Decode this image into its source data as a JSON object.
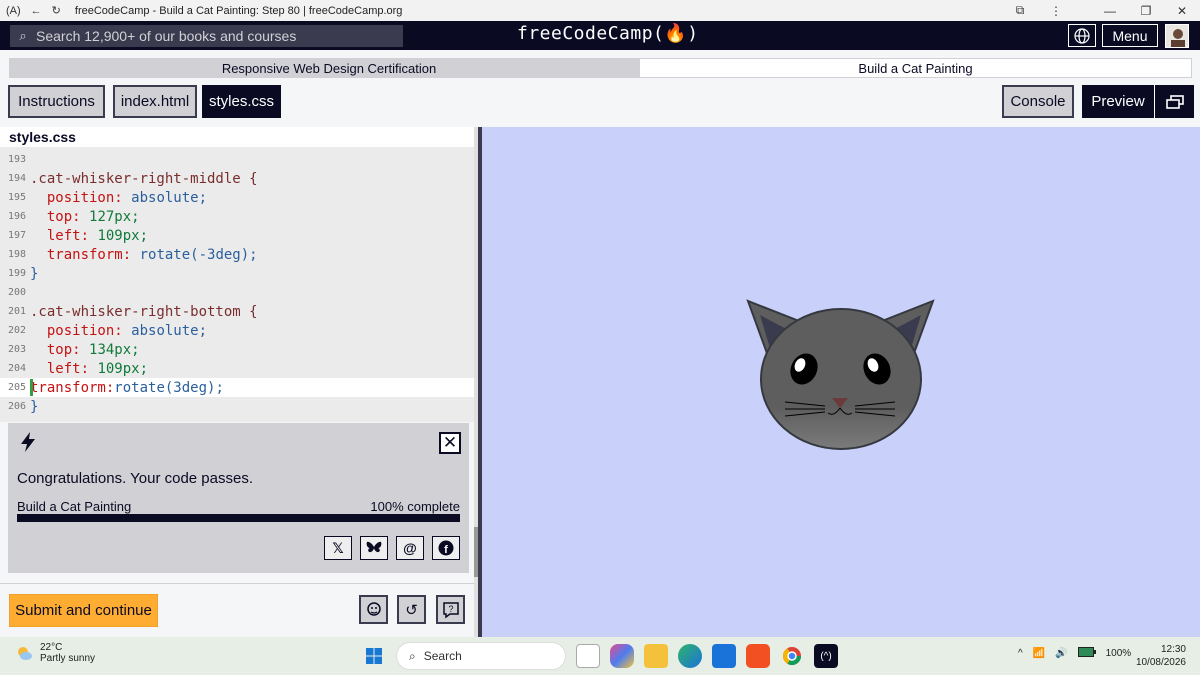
{
  "browser": {
    "title": "freeCodeCamp - Build a Cat Painting: Step 80 | freeCodeCamp.org",
    "badge": "(A)"
  },
  "nav": {
    "search_placeholder": "Search 12,900+ of our books and courses",
    "logo": "freeCodeCamp(🔥)",
    "menu_label": "Menu"
  },
  "breadcrumb": {
    "cert": "Responsive Web Design Certification",
    "project": "Build a Cat Painting"
  },
  "tabs": {
    "instructions": "Instructions",
    "index_html": "index.html",
    "styles_css": "styles.css",
    "console": "Console",
    "preview": "Preview"
  },
  "editor": {
    "file_label": "styles.css",
    "lines": [
      {
        "n": "193"
      },
      {
        "n": "194"
      },
      {
        "n": "195"
      },
      {
        "n": "196"
      },
      {
        "n": "197"
      },
      {
        "n": "198"
      },
      {
        "n": "199"
      },
      {
        "n": "200"
      },
      {
        "n": "201"
      },
      {
        "n": "202"
      },
      {
        "n": "203"
      },
      {
        "n": "204"
      },
      {
        "n": "205"
      },
      {
        "n": "206"
      }
    ],
    "code": {
      "l194_sel": ".cat-whisker-right-middle {",
      "l195_prop": "position:",
      "l195_val": "absolute;",
      "l196_prop": "top:",
      "l196_val": "127px;",
      "l197_prop": "left:",
      "l197_val": "109px;",
      "l198_prop": "transform:",
      "l198_val": "rotate(-3deg);",
      "l199": "}",
      "l201_sel": ".cat-whisker-right-bottom {",
      "l202_prop": "position:",
      "l202_val": "absolute;",
      "l203_prop": "top:",
      "l203_val": "134px;",
      "l204_prop": "left:",
      "l204_val": "109px;",
      "l205_prop": "transform:",
      "l205_val": "rotate(3deg);",
      "l206": "}"
    }
  },
  "congrats": {
    "message": "Congratulations. Your code passes.",
    "progress_label": "Build a Cat Painting",
    "progress_text": "100% complete",
    "progress": 1.0,
    "share": {
      "x": "𝕏",
      "threads": "@",
      "facebook": "f"
    }
  },
  "actions": {
    "submit": "Submit and continue"
  },
  "taskbar": {
    "temp": "22°C",
    "weather": "Partly sunny",
    "search": "Search",
    "battery": "100%",
    "time": "12:30",
    "date": "10/08/2026"
  },
  "colors": {
    "dark": "#0a0a23",
    "gray": "#d0d0d5",
    "accent": "#feac32",
    "preview_bg": "#c9d0fa"
  }
}
